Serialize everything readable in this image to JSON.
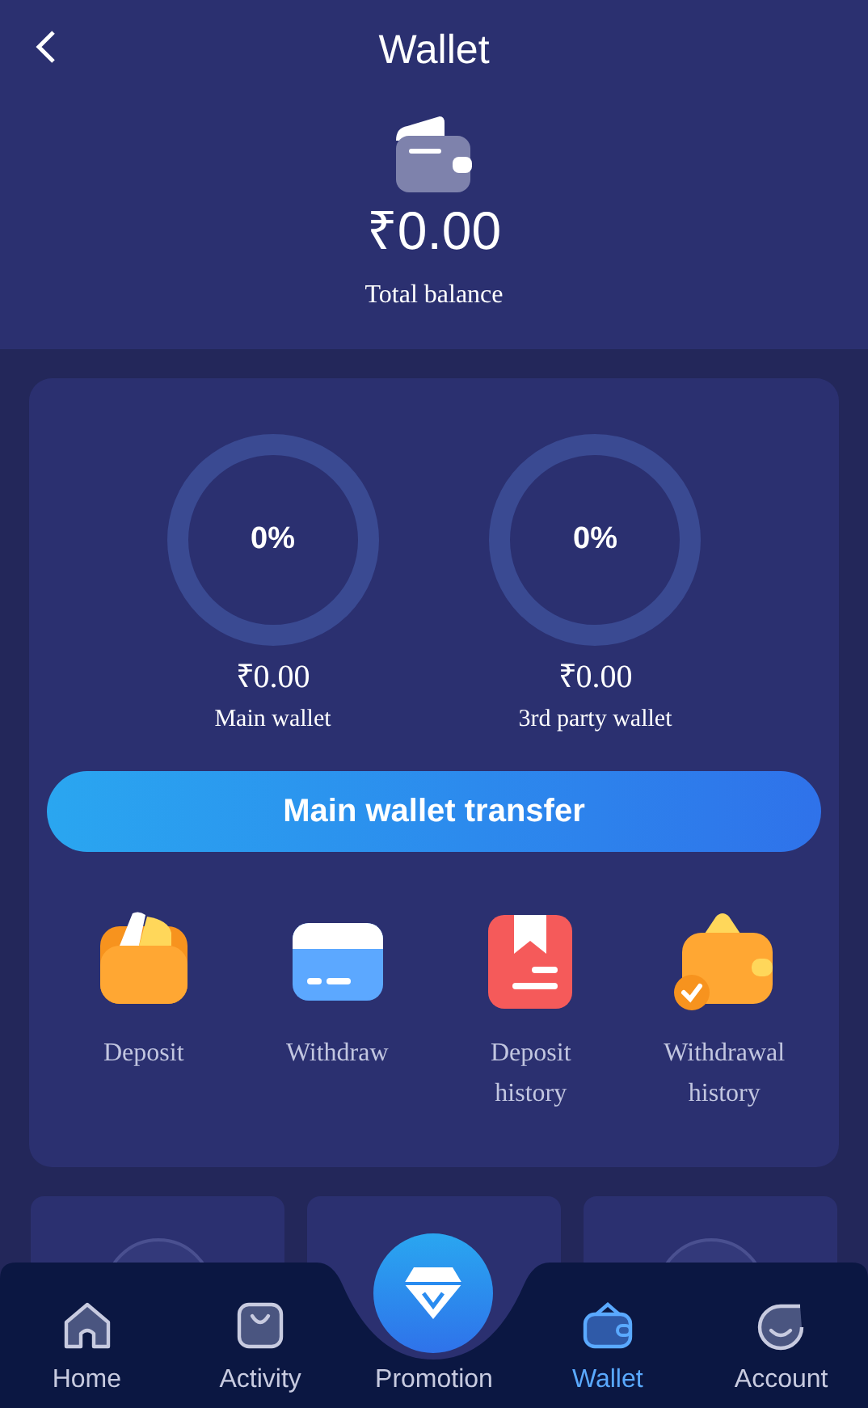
{
  "header": {
    "title": "Wallet"
  },
  "total": {
    "amount": "₹0.00",
    "label": "Total balance"
  },
  "wallets": [
    {
      "percent": "0%",
      "amount": "₹0.00",
      "label": "Main wallet"
    },
    {
      "percent": "0%",
      "amount": "₹0.00",
      "label": "3rd party wallet"
    }
  ],
  "transfer_button": "Main wallet transfer",
  "actions": [
    {
      "kind": "deposit",
      "label": "Deposit"
    },
    {
      "kind": "withdraw",
      "label": "Withdraw"
    },
    {
      "kind": "deposit_history",
      "label": "Deposit history"
    },
    {
      "kind": "withdrawal_history",
      "label": "Withdrawal history"
    }
  ],
  "nav": [
    {
      "kind": "home",
      "label": "Home",
      "selected": false
    },
    {
      "kind": "activity",
      "label": "Activity",
      "selected": false
    },
    {
      "kind": "promotion",
      "label": "Promotion",
      "selected": false
    },
    {
      "kind": "wallet",
      "label": "Wallet",
      "selected": true
    },
    {
      "kind": "account",
      "label": "Account",
      "selected": false
    }
  ]
}
